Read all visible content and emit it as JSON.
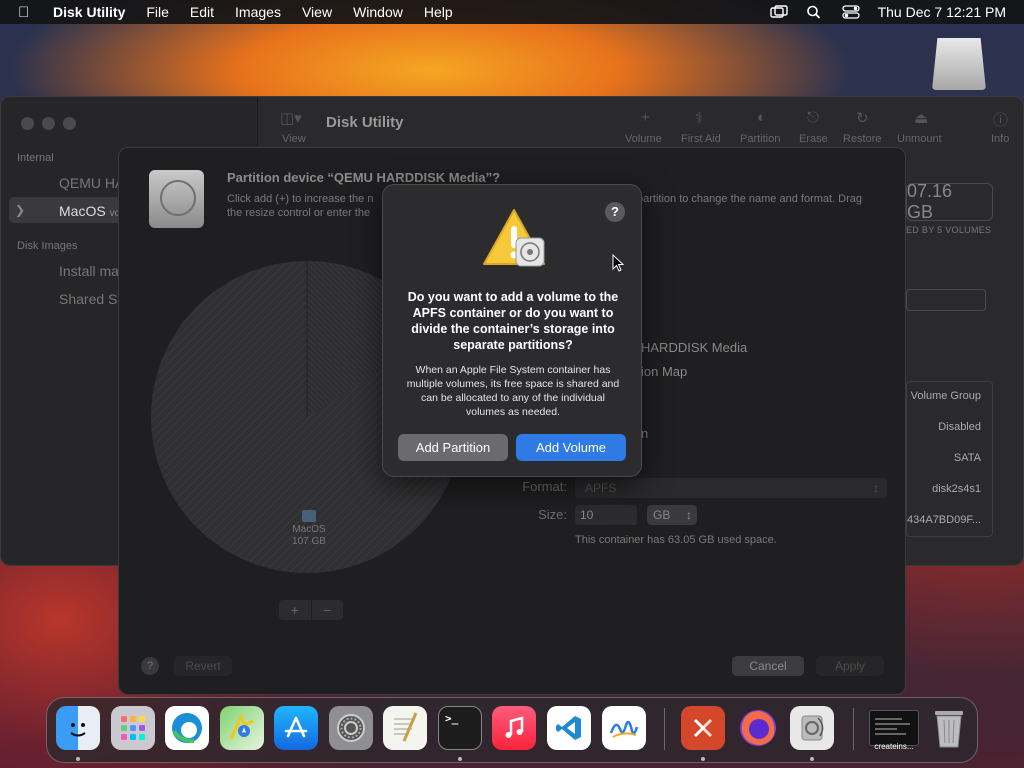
{
  "menubar": {
    "app_name": "Disk Utility",
    "items": [
      "File",
      "Edit",
      "Images",
      "View",
      "Window",
      "Help"
    ],
    "clock": "Thu Dec 7  12:21 PM",
    "status_icons": [
      "screen-mirroring-icon",
      "spotlight-search-icon",
      "control-center-icon"
    ]
  },
  "main_window": {
    "title": "Disk Utility",
    "toolbar": [
      "View",
      "First Aid",
      "Partition",
      "Erase",
      "Restore",
      "Unmount",
      "Info"
    ],
    "sidebar": {
      "section_internal": "Internal",
      "items": [
        "QEMU HA",
        "MacOS"
      ],
      "selected_suffix": "vo",
      "section_images": "Disk Images",
      "images": [
        "Install ma",
        "Shared Su"
      ]
    },
    "capacity": "07.16 GB",
    "capacity_sub": "ED BY 5 VOLUMES",
    "info_values": [
      "Volume Group",
      "Disabled",
      "SATA",
      "disk2s4s1",
      "434A7BD09F..."
    ]
  },
  "sheet": {
    "title": "Partition device “QEMU HARDDISK Media”?",
    "desc_left_1": "Click add (+) to increase the n",
    "desc_left_2": "the resize control or enter the",
    "desc_right": "partition to change the name and format. Drag",
    "pie_volume_name": "MacOS",
    "pie_volume_size": "107 GB",
    "disk_name": "HARDDISK Media",
    "partition_map": "ion Map",
    "partition_n": "n",
    "format_label": "Format:",
    "format_value": "APFS",
    "size_label": "Size:",
    "size_value": "10",
    "size_unit": "GB",
    "container_note": "This container has 63.05 GB used space.",
    "plus": "+",
    "minus": "−",
    "help": "?",
    "revert": "Revert",
    "cancel": "Cancel",
    "apply": "Apply"
  },
  "alert": {
    "help": "?",
    "title": "Do you want to add a volume to the APFS container or do you want to divide the container’s storage into separate partitions?",
    "body": "When an Apple File System container has multiple volumes, its free space is shared and can be allocated to any of the individual volumes as needed.",
    "secondary_button": "Add Partition",
    "primary_button": "Add Volume",
    "primary_color": "#2f7ae5"
  },
  "dock": {
    "apps": [
      "Finder",
      "Launchpad",
      "Microsoft Edge",
      "Maps",
      "App Store",
      "System Preferences",
      "TextEdit",
      "Terminal",
      "Music",
      "Visual Studio Code",
      "Freeform",
      "Remote Desktop",
      "Firefox",
      "Disk Utility"
    ],
    "minimized_caption": "createins...",
    "trash": "Trash"
  }
}
